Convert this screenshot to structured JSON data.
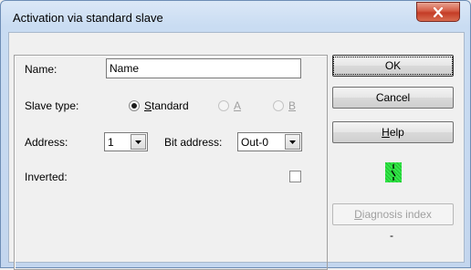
{
  "window": {
    "title": "Activation via standard slave"
  },
  "form": {
    "name_label": "Name:",
    "name_value": "Name",
    "slave_type_label": "Slave type:",
    "slave_types": [
      {
        "pre": "",
        "mnemonic": "S",
        "post": "tandard",
        "selected": true,
        "enabled": true
      },
      {
        "pre": "",
        "mnemonic": "A",
        "post": "",
        "selected": false,
        "enabled": false
      },
      {
        "pre": "",
        "mnemonic": "B",
        "post": "",
        "selected": false,
        "enabled": false
      }
    ],
    "address_label": "Address:",
    "address_value": "1",
    "bit_address_label": "Bit address:",
    "bit_address_value": "Out-0",
    "inverted_label": "Inverted:",
    "inverted_checked": false
  },
  "buttons": {
    "ok": "OK",
    "cancel": "Cancel",
    "help_mnemonic": "H",
    "help_rest": "elp",
    "diag_mnemonic": "D",
    "diag_rest": "iagnosis index"
  },
  "status": {
    "diag_value": "-"
  },
  "colors": {
    "indicator": "#33e84a",
    "close_button": "#c43c26"
  }
}
